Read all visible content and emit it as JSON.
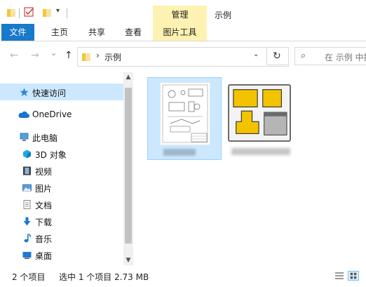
{
  "titlebar": {
    "context_tab_header": "管理",
    "window_title": "示例",
    "dropdown_glyph": "▾"
  },
  "ribbon": {
    "tabs": [
      {
        "label": "文件"
      },
      {
        "label": "主页"
      },
      {
        "label": "共享"
      },
      {
        "label": "查看"
      },
      {
        "label": "图片工具"
      }
    ]
  },
  "nav": {
    "back_glyph": "←",
    "forward_glyph": "→",
    "recent_glyph": "⌄",
    "up_glyph": "↑",
    "address": {
      "chevron": "›",
      "path": "示例",
      "dropdown_glyph": "⌄"
    },
    "refresh_glyph": "↻",
    "search": {
      "placeholder": "在 示例 中搜",
      "icon_glyph": "⌕"
    }
  },
  "sidebar": {
    "items": [
      {
        "label": "快速访问",
        "icon": "pin-star-icon",
        "selected": true
      },
      {
        "label": "OneDrive",
        "icon": "cloud-icon",
        "selected": false
      },
      {
        "label": "此电脑",
        "icon": "computer-icon",
        "selected": false
      },
      {
        "label": "3D 对象",
        "icon": "cube-3d-icon",
        "selected": false
      },
      {
        "label": "视频",
        "icon": "film-icon",
        "selected": false
      },
      {
        "label": "图片",
        "icon": "picture-icon",
        "selected": false
      },
      {
        "label": "文档",
        "icon": "document-icon",
        "selected": false
      },
      {
        "label": "下载",
        "icon": "download-arrow-icon",
        "selected": false
      },
      {
        "label": "音乐",
        "icon": "music-note-icon",
        "selected": false
      },
      {
        "label": "桌面",
        "icon": "desktop-icon",
        "selected": false
      }
    ],
    "scroll_up_glyph": "▲",
    "scroll_down_glyph": "▼"
  },
  "files": [
    {
      "name_hidden": true,
      "thumbnail": "technical-drawing-thumbnail",
      "selected": true
    },
    {
      "name_hidden": true,
      "thumbnail": "layout-blocks-thumbnail",
      "selected": false
    }
  ],
  "status": {
    "item_count": "2 个项目",
    "selection": "选中 1 个项目  2.73 MB"
  },
  "colors": {
    "file_tab": "#1979ca",
    "picture_tools": "#fdf2b1",
    "selection": "#cce8ff",
    "folder": "#f4c542",
    "accent_blue": "#0078d7"
  }
}
